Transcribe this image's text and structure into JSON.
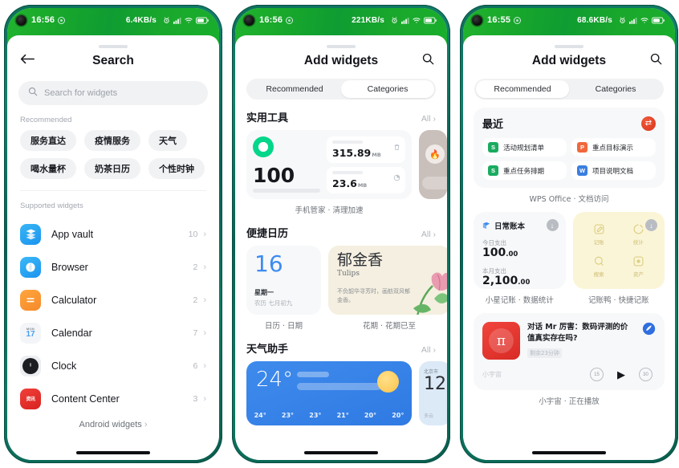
{
  "phones": [
    {
      "id": "phone-search",
      "status": {
        "time": "16:56",
        "speed": "6.4KB/s"
      },
      "screen_title": "Search",
      "search": {
        "placeholder": "Search for widgets"
      },
      "recommended_label": "Recommended",
      "chips": [
        "服务直达",
        "疫情服务",
        "天气",
        "喝水量杯",
        "奶茶日历",
        "个性时钟"
      ],
      "supported_label": "Supported widgets",
      "apps": [
        {
          "name": "App vault",
          "count": "10"
        },
        {
          "name": "Browser",
          "count": "2"
        },
        {
          "name": "Calculator",
          "count": "2"
        },
        {
          "name": "Calendar",
          "count": "7",
          "icon_text": "17"
        },
        {
          "name": "Clock",
          "count": "6"
        },
        {
          "name": "Content Center",
          "count": "3"
        }
      ],
      "footer_link": "Android widgets"
    },
    {
      "id": "phone-categories",
      "status": {
        "time": "16:56",
        "speed": "221KB/s"
      },
      "screen_title": "Add widgets",
      "tabs": [
        {
          "label": "Recommended",
          "active": false
        },
        {
          "label": "Categories",
          "active": true
        }
      ],
      "sections": [
        {
          "title": "实用工具",
          "all": "All",
          "manager": {
            "score": "100",
            "tile1_value": "315.89",
            "tile1_unit": "MB",
            "tile2_value": "23.6",
            "tile2_unit": "MB",
            "label": "手机管家 · 清理加速"
          }
        },
        {
          "title": "便捷日历",
          "all": "All",
          "calendar": {
            "day": "16",
            "weekday": "星期一",
            "lunar": "农历 七月初九",
            "label": "日历 · 日期"
          },
          "flower": {
            "title": "郁金香",
            "subtitle": "Tulips",
            "desc": "不负韶华寻芳时，画舫双风郁金香。",
            "label": "花期 · 花期已至"
          }
        },
        {
          "title": "天气助手",
          "all": "All",
          "weather": {
            "temp": "24°",
            "hours": [
              "24°",
              "23°",
              "23°",
              "21°",
              "20°",
              "20°"
            ]
          },
          "weather_partial": {
            "city": "北京市",
            "temp": "12",
            "sub": "多云"
          }
        }
      ]
    },
    {
      "id": "phone-recommended",
      "status": {
        "time": "16:55",
        "speed": "68.6KB/s"
      },
      "screen_title": "Add widgets",
      "tabs": [
        {
          "label": "Recommended",
          "active": true
        },
        {
          "label": "Categories",
          "active": false
        }
      ],
      "recent": {
        "title": "最近",
        "documents": [
          {
            "name": "活动规划清单",
            "kind": "S",
            "color": "#1aab5f"
          },
          {
            "name": "重点目标演示",
            "kind": "P",
            "color": "#f0683c"
          },
          {
            "name": "重点任务排期",
            "kind": "S",
            "color": "#1aab5f"
          },
          {
            "name": "项目说明文档",
            "kind": "W",
            "color": "#3a7ee0"
          }
        ],
        "label": "WPS Office · 文档访问"
      },
      "ledger": {
        "title": "日常账本",
        "today_label": "今日支出",
        "today_value": "100",
        "today_cents": ".00",
        "month_label": "本月支出",
        "month_value": "2,100",
        "month_cents": ".00",
        "label": "小星记账 · 数据统计"
      },
      "quick_ledger": {
        "items": [
          {
            "label": "记账",
            "icon": "edit-icon"
          },
          {
            "label": "统计",
            "icon": "pie-chart-icon"
          },
          {
            "label": "搜索",
            "icon": "search-icon"
          },
          {
            "label": "资产",
            "icon": "wallet-icon"
          }
        ],
        "label": "记账鸭 · 快捷记账"
      },
      "podcast": {
        "title": "对话 Mr 厉害：数码评测的价值真实存在吗?",
        "duration": "剩余23分钟",
        "app_name": "小宇宙",
        "skip_back": "15",
        "skip_forward": "30",
        "label": "小宇宙 · 正在播放"
      }
    }
  ],
  "colors": {
    "status_green": "#19a82b",
    "bezel": "#0d6f5c",
    "accent_blue": "#3d8bf2",
    "accent_red": "#e23b30"
  },
  "icons": {
    "back": "back-arrow-icon",
    "search": "search-icon",
    "chevron": "chevron-right-icon",
    "alarm": "alarm-icon",
    "signal": "signal-icon",
    "wifi": "wifi-icon",
    "battery": "battery-icon"
  }
}
